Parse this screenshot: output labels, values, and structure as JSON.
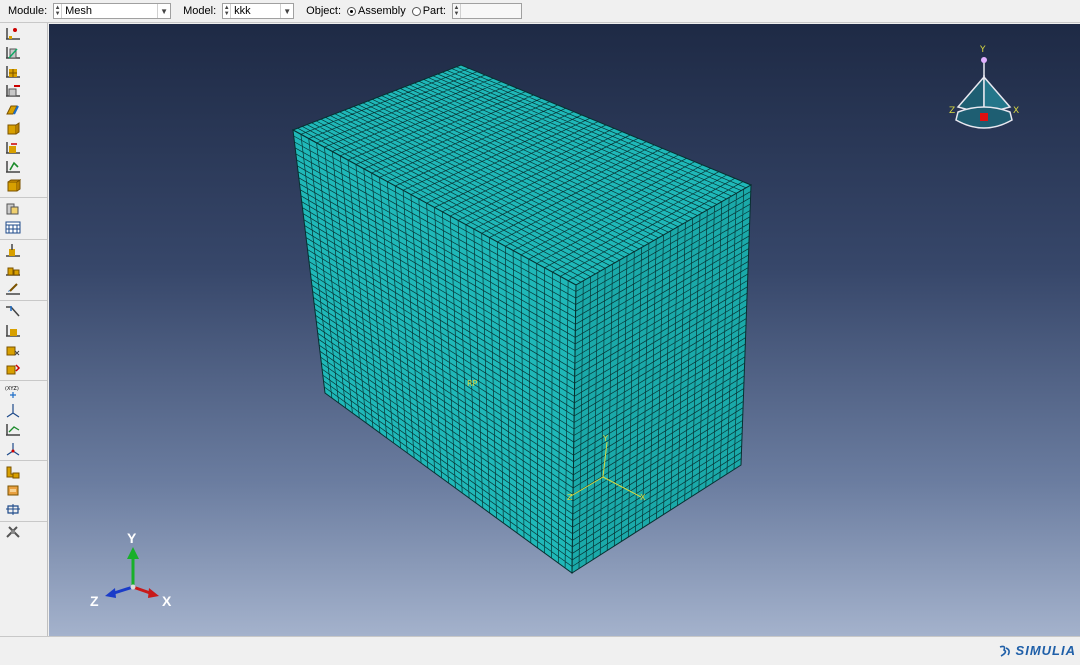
{
  "toolbar": {
    "module_label": "Module:",
    "module_value": "Mesh",
    "model_label": "Model:",
    "model_value": "kkk",
    "object_label": "Object:",
    "assembly_label": "Assembly",
    "part_label": "Part:",
    "part_value": ""
  },
  "viewport": {
    "triad_x": "X",
    "triad_y": "Y",
    "triad_z": "Z",
    "compass_x": "X",
    "compass_y": "Y",
    "compass_z": "Z",
    "mesh_color": "#1fb8b8"
  },
  "brand": {
    "text": "SIMULIA"
  },
  "icons": [
    "seed-part-icon",
    "seed-edge-icon",
    "mesh-part-icon",
    "delete-mesh-icon",
    "mesh-controls-icon",
    "element-type-icon",
    "verify-mesh-icon",
    "partition-icon",
    "virtual-topology-icon",
    "query-icon",
    "mesh-region-icon",
    "edit-mesh-icon",
    "create-datum-point-icon",
    "create-datum-axis-icon",
    "datum-plane-icon",
    "datum-csys-icon",
    "create-display-group-icon",
    "replace-icon",
    "partition-cell-icon",
    "tools-icon"
  ]
}
